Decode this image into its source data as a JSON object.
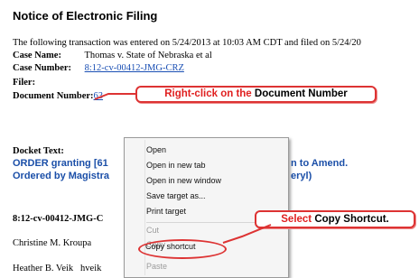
{
  "page": {
    "heading": "Notice of Electronic Filing",
    "intro": "The following transaction was entered on 5/24/2013 at 10:03 AM CDT and filed on 5/24/20"
  },
  "fields": {
    "case_name_label": "Case Name:",
    "case_name_value": "Thomas v. State of Nebraska et al",
    "case_number_label": "Case Number:",
    "case_number_value": "8:12-cv-00412-JMG-CRZ",
    "filer_label": "Filer:",
    "document_number_label": "Document Number:",
    "document_number_value": "63"
  },
  "docket": {
    "label": "Docket Text:",
    "line1_left": "ORDER granting [61",
    "line1_right": "n to Amend.",
    "line2_left": "Ordered by Magistra",
    "line2_right": "eryl)"
  },
  "case_line": "8:12-cv-00412-JMG-C",
  "people": {
    "person1": "Christine M. Kroupa",
    "person2_name": "Heather B. Veik",
    "person2_extra": "hveik"
  },
  "callouts": {
    "right_click_prefix": "Right-click on the ",
    "right_click_emph": "Document Number",
    "select_prefix": "Select ",
    "select_emph": "Copy Shortcut."
  },
  "context_menu": {
    "items": [
      "Open",
      "Open in new tab",
      "Open in new window",
      "Save target as...",
      "Print target",
      "Cut",
      "Copy",
      "Copy shortcut",
      "Paste"
    ]
  }
}
